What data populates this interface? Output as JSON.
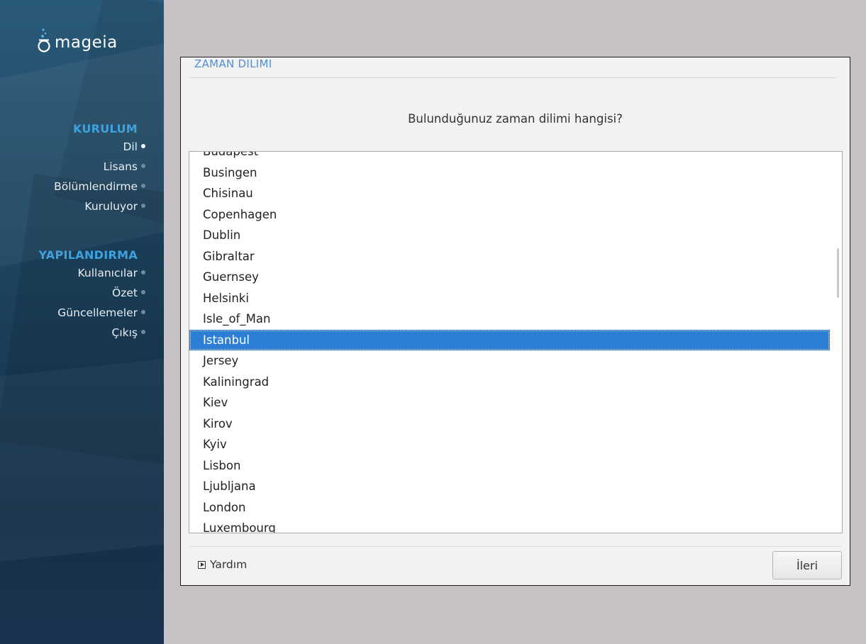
{
  "sidebar": {
    "logo_text": "mageia",
    "sections": [
      {
        "title": "KURULUM",
        "steps": [
          {
            "label": "Dil",
            "active": true
          },
          {
            "label": "Lisans",
            "active": false
          },
          {
            "label": "Bölümlendirme",
            "active": false
          },
          {
            "label": "Kuruluyor",
            "active": false
          }
        ]
      },
      {
        "title": "YAPILANDIRMA",
        "steps": [
          {
            "label": "Kullanıcılar",
            "active": false
          },
          {
            "label": "Özet",
            "active": false
          },
          {
            "label": "Güncellemeler",
            "active": false
          },
          {
            "label": "Çıkış",
            "active": false
          }
        ]
      }
    ]
  },
  "dialog": {
    "title": "ZAMAN DILIMI",
    "question": "Bulunduğunuz zaman dilimi hangisi?",
    "timezones": [
      "Budapest",
      "Busingen",
      "Chisinau",
      "Copenhagen",
      "Dublin",
      "Gibraltar",
      "Guernsey",
      "Helsinki",
      "Isle_of_Man",
      "Istanbul",
      "Jersey",
      "Kaliningrad",
      "Kiev",
      "Kirov",
      "Kyiv",
      "Lisbon",
      "Ljubljana",
      "London",
      "Luxembourg"
    ],
    "selected": "Istanbul",
    "help_label": "Yardım",
    "next_label": "İleri"
  },
  "colors": {
    "accent": "#3da2de",
    "selection": "#2d7ed7",
    "title": "#4f8fd6"
  }
}
